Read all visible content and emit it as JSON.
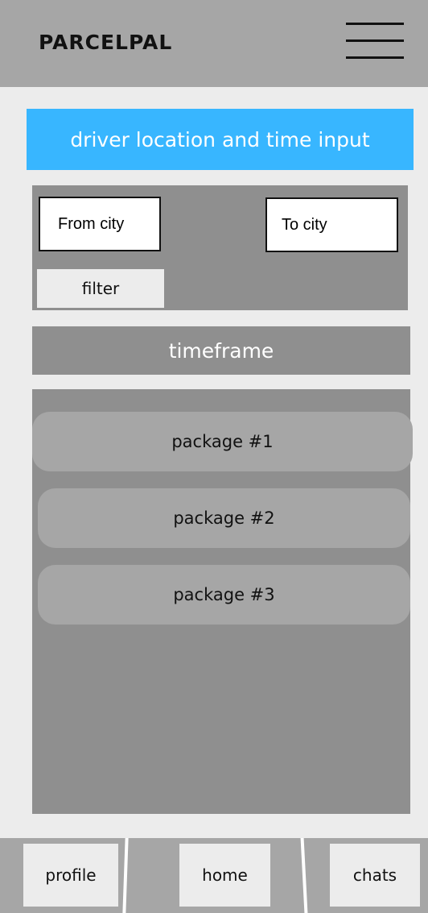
{
  "app": {
    "brand": "PARCELPAL"
  },
  "header": {
    "menu_icon": "hamburger-menu-icon"
  },
  "banner": {
    "title": "driver location and time input"
  },
  "filters": {
    "from_placeholder": "From city",
    "from_value": "",
    "to_placeholder": "To city",
    "to_value": "",
    "filter_label": "filter"
  },
  "timeframe": {
    "label": "timeframe"
  },
  "packages": [
    {
      "label": "package #1"
    },
    {
      "label": "package #2"
    },
    {
      "label": "package #3"
    }
  ],
  "bottom_nav": {
    "profile_label": "profile",
    "home_label": "home",
    "chats_label": "chats"
  },
  "colors": {
    "header_bg": "#a6a6a6",
    "screen_bg": "#ececec",
    "accent": "#38b6ff",
    "panel_bg": "#8f8f8f"
  }
}
